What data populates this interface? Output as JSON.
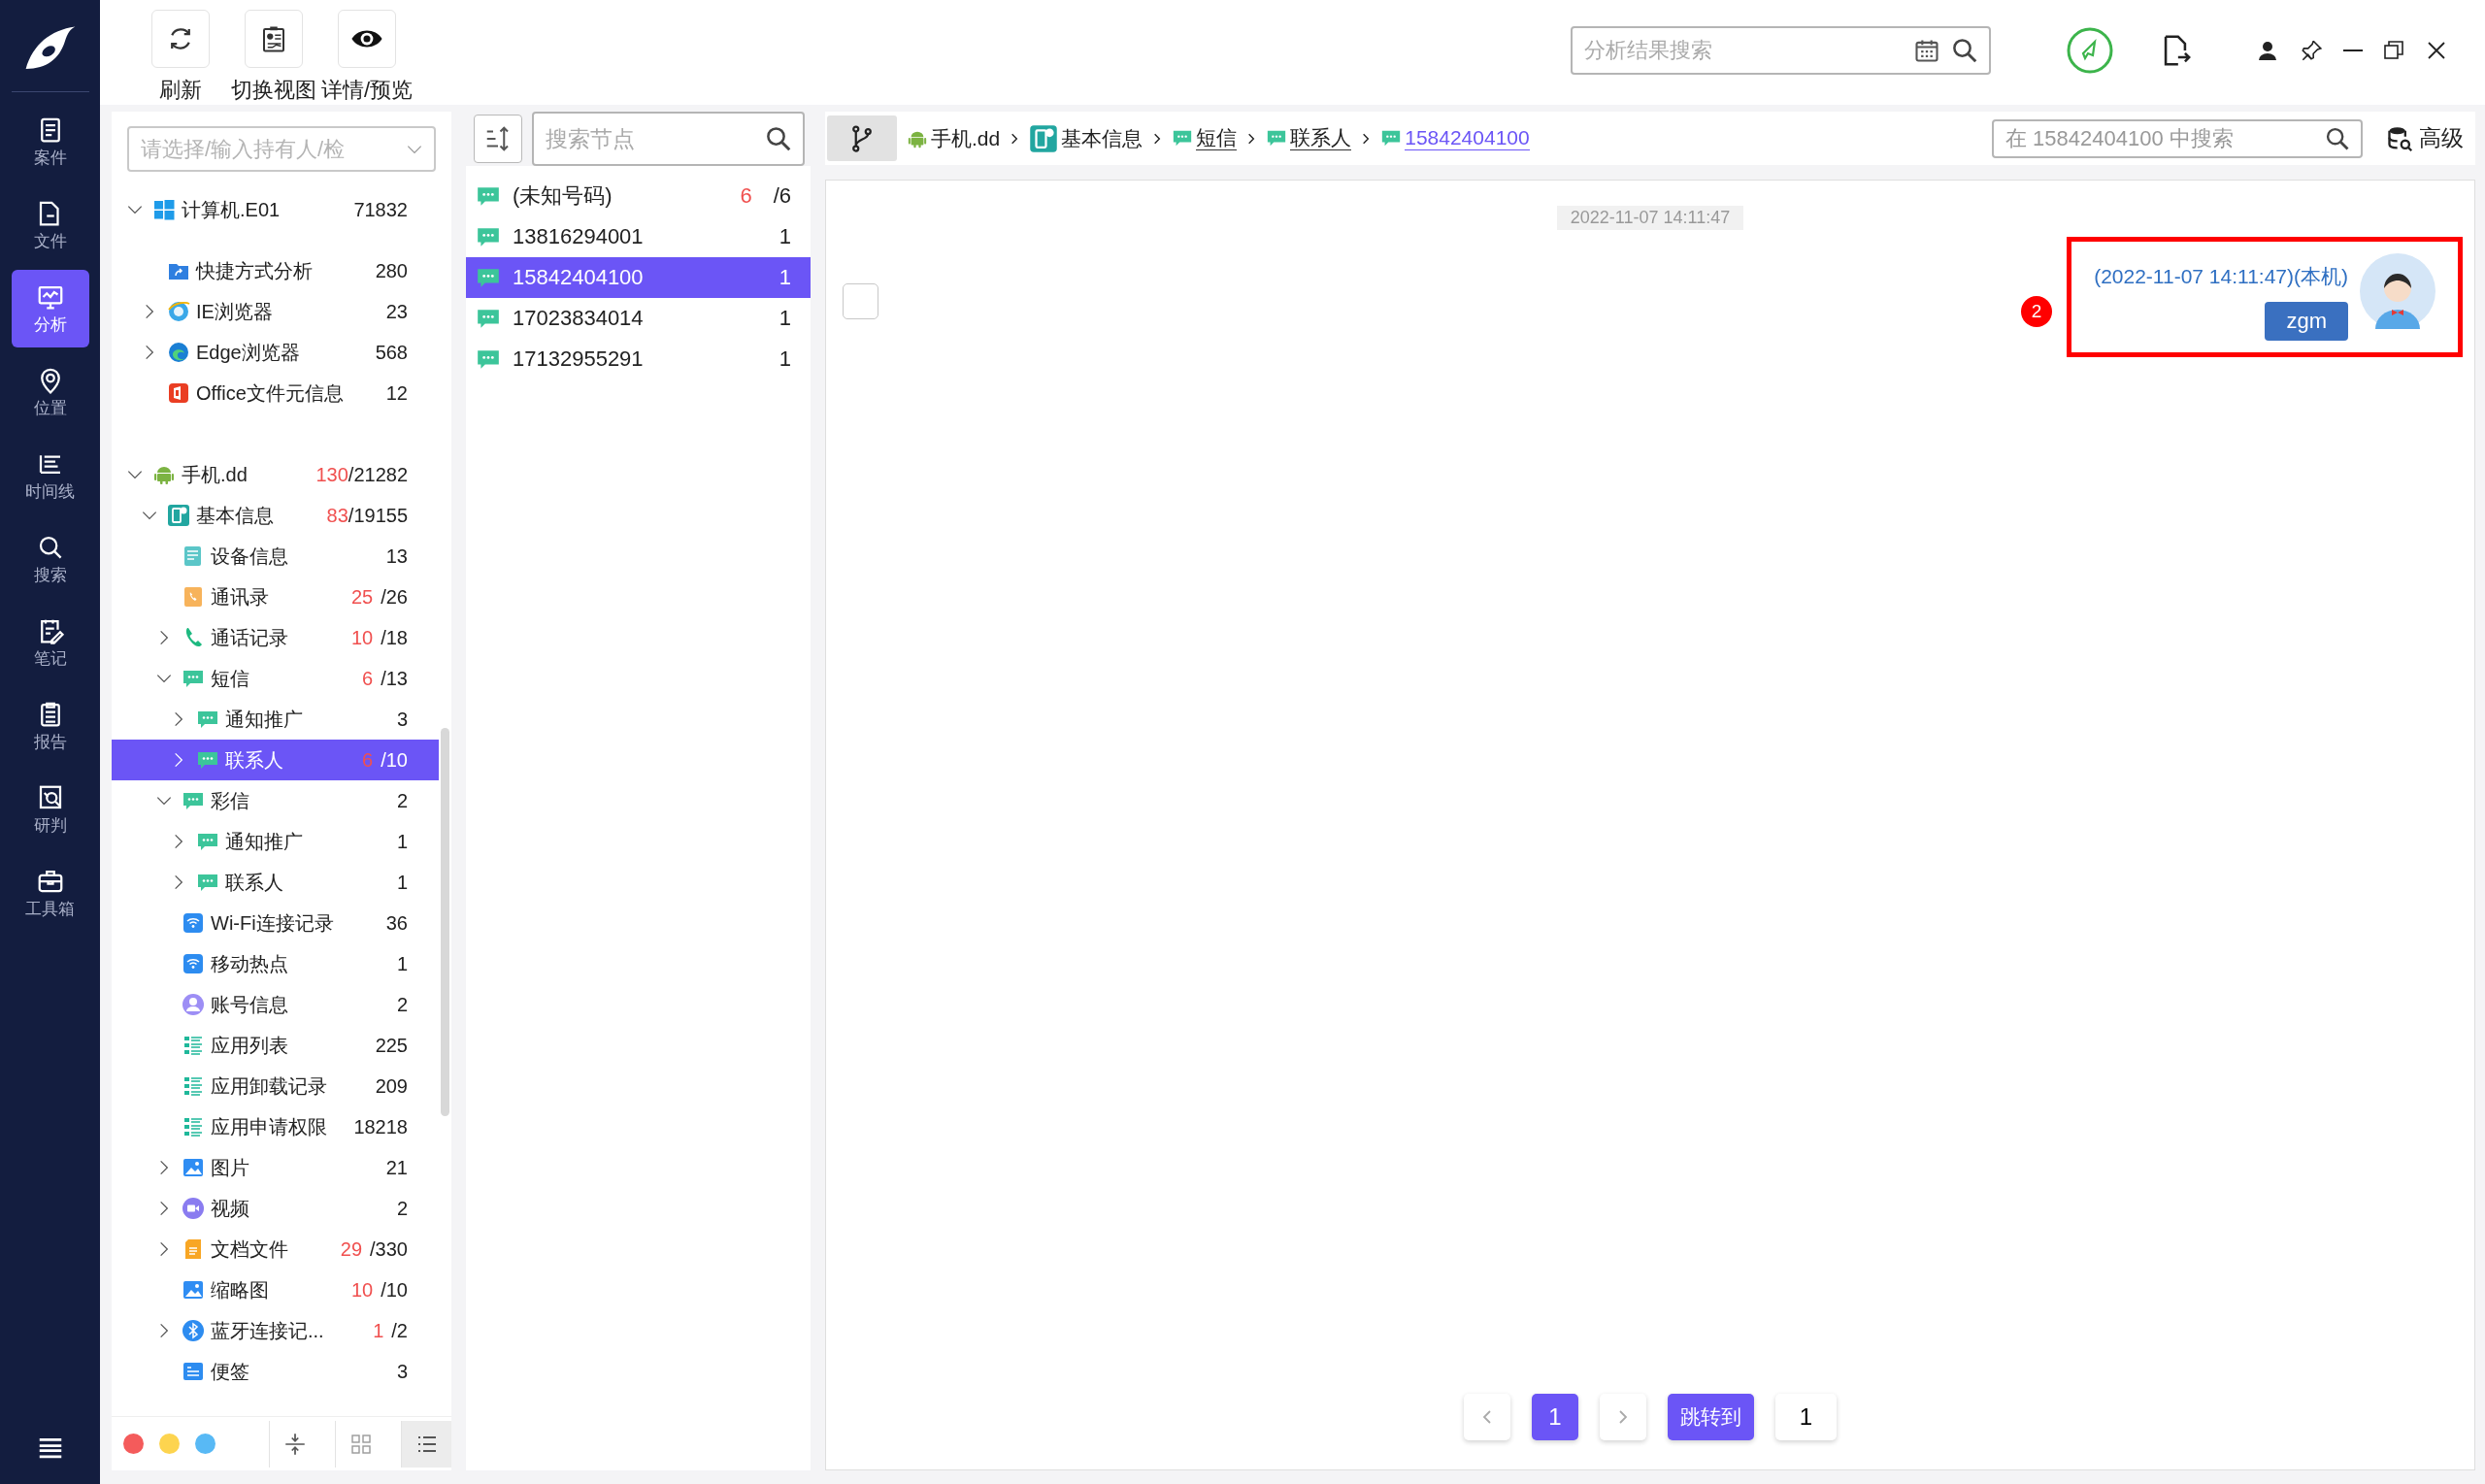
{
  "nav": {
    "items": [
      {
        "label": "案件",
        "kind": "case",
        "selected": false
      },
      {
        "label": "文件",
        "kind": "file",
        "selected": false
      },
      {
        "label": "分析",
        "kind": "analysis",
        "selected": true
      },
      {
        "label": "位置",
        "kind": "location",
        "selected": false
      },
      {
        "label": "时间线",
        "kind": "timeline",
        "selected": false
      },
      {
        "label": "搜索",
        "kind": "search",
        "selected": false
      },
      {
        "label": "笔记",
        "kind": "notes",
        "selected": false
      },
      {
        "label": "报告",
        "kind": "report",
        "selected": false
      },
      {
        "label": "研判",
        "kind": "judge",
        "selected": false
      },
      {
        "label": "工具箱",
        "kind": "toolbox",
        "selected": false
      }
    ]
  },
  "toolbar": {
    "buttons": [
      {
        "label": "刷新",
        "kind": "refresh"
      },
      {
        "label": "切换视图",
        "kind": "switch"
      },
      {
        "label": "详情/预览",
        "kind": "preview"
      }
    ],
    "search": {
      "placeholder": "分析结果搜索"
    }
  },
  "tree": {
    "filter": {
      "placeholder": "请选择/输入持有人/检"
    },
    "roots": [
      {
        "label": "计算机.E01",
        "kind": "windows",
        "count": "71832",
        "expanded": true,
        "selected": false,
        "children": [
          {
            "label": "快捷方式分析",
            "kind": "shortcut",
            "count": "280",
            "selected": false
          },
          {
            "label": "IE浏览器",
            "kind": "ie",
            "count": "23",
            "expanded": false,
            "selected": false
          },
          {
            "label": "Edge浏览器",
            "kind": "edge",
            "count": "568",
            "expanded": false,
            "selected": false
          },
          {
            "label": "Office文件元信息",
            "kind": "office",
            "count": "12",
            "selected": false
          }
        ]
      },
      {
        "label": "手机.dd",
        "kind": "android",
        "new": "130",
        "count": "/21282",
        "expanded": true,
        "selected": false,
        "children": [
          {
            "label": "基本信息",
            "kind": "info",
            "new": "83",
            "count": "/19155",
            "expanded": true,
            "selected": false,
            "children": [
              {
                "label": "设备信息",
                "kind": "device",
                "count": "13",
                "selected": false
              },
              {
                "label": "通讯录",
                "kind": "contacts",
                "new": "25",
                "count": "/26",
                "selected": false
              },
              {
                "label": "通话记录",
                "kind": "calls",
                "new": "10",
                "count": "/18",
                "expanded": false,
                "selected": false
              },
              {
                "label": "短信",
                "kind": "sms",
                "new": "6",
                "count": "/13",
                "expanded": true,
                "selected": false,
                "children": [
                  {
                    "label": "通知推广",
                    "kind": "sms",
                    "count": "3",
                    "expanded": false,
                    "selected": false
                  },
                  {
                    "label": "联系人",
                    "kind": "sms",
                    "new": "6",
                    "count": "/10",
                    "expanded": false,
                    "selected": true
                  }
                ]
              },
              {
                "label": "彩信",
                "kind": "sms",
                "count": "2",
                "expanded": true,
                "selected": false,
                "children": [
                  {
                    "label": "通知推广",
                    "kind": "sms",
                    "count": "1",
                    "expanded": false,
                    "selected": false
                  },
                  {
                    "label": "联系人",
                    "kind": "sms",
                    "count": "1",
                    "expanded": false,
                    "selected": false
                  }
                ]
              },
              {
                "label": "Wi-Fi连接记录",
                "kind": "wifi",
                "count": "36",
                "selected": false
              },
              {
                "label": "移动热点",
                "kind": "wifi",
                "count": "1",
                "selected": false
              },
              {
                "label": "账号信息",
                "kind": "account",
                "count": "2",
                "selected": false
              },
              {
                "label": "应用列表",
                "kind": "applist",
                "count": "225",
                "selected": false
              },
              {
                "label": "应用卸载记录",
                "kind": "applist",
                "count": "209",
                "selected": false
              },
              {
                "label": "应用申请权限",
                "kind": "applist",
                "count": "18218",
                "selected": false
              },
              {
                "label": "图片",
                "kind": "image",
                "count": "21",
                "expanded": false,
                "selected": false
              },
              {
                "label": "视频",
                "kind": "video",
                "count": "2",
                "expanded": false,
                "selected": false
              },
              {
                "label": "文档文件",
                "kind": "document",
                "new": "29",
                "count": "/330",
                "expanded": false,
                "selected": false
              },
              {
                "label": "缩略图",
                "kind": "image",
                "new": "10",
                "count": "/10",
                "selected": false
              },
              {
                "label": "蓝牙连接记...",
                "kind": "bluetooth",
                "new": "1",
                "count": "/2",
                "expanded": false,
                "selected": false
              },
              {
                "label": "便签",
                "kind": "note",
                "count": "3",
                "selected": false
              }
            ]
          }
        ]
      }
    ],
    "color_filters": [
      {
        "color": "#f45b5b"
      },
      {
        "color": "#fdd44f"
      },
      {
        "color": "#58b9f5"
      }
    ],
    "view_buttons": [
      {
        "kind": "collapse",
        "selected": false
      },
      {
        "kind": "grid",
        "selected": false
      },
      {
        "kind": "list",
        "selected": true
      }
    ]
  },
  "list": {
    "search": {
      "placeholder": "搜索节点"
    },
    "items": [
      {
        "label": "(未知号码)",
        "new": "6",
        "count": "/6",
        "selected": false
      },
      {
        "label": "13816294001",
        "count": "1",
        "selected": false
      },
      {
        "label": "15842404100",
        "count": "1",
        "selected": true
      },
      {
        "label": "17023834014",
        "count": "1",
        "selected": false
      },
      {
        "label": "17132955291",
        "count": "1",
        "selected": false
      }
    ]
  },
  "detail": {
    "breadcrumb": [
      {
        "label": "手机.dd",
        "kind": "android",
        "link": false,
        "selected": false
      },
      {
        "label": "基本信息",
        "kind": "info",
        "link": false,
        "selected": false
      },
      {
        "label": "短信",
        "kind": "sms",
        "link": true,
        "selected": false
      },
      {
        "label": "联系人",
        "kind": "sms",
        "link": true,
        "selected": false
      },
      {
        "label": "15842404100",
        "kind": "sms",
        "link": true,
        "selected": true
      }
    ],
    "search": {
      "placeholder": "在 15842404100 中搜索"
    },
    "advanced_label": "高级",
    "date": "2022-11-07 14:11:47",
    "messages": [
      {
        "sender": "(2022-11-07 14:11:47)(本机)",
        "text": "zgm",
        "checked": false,
        "highlighted": true,
        "badge": "2"
      }
    ],
    "pagination": {
      "pages": [
        {
          "label": "1",
          "selected": true
        }
      ],
      "jump_label": "跳转到",
      "jump_value": "1"
    }
  }
}
